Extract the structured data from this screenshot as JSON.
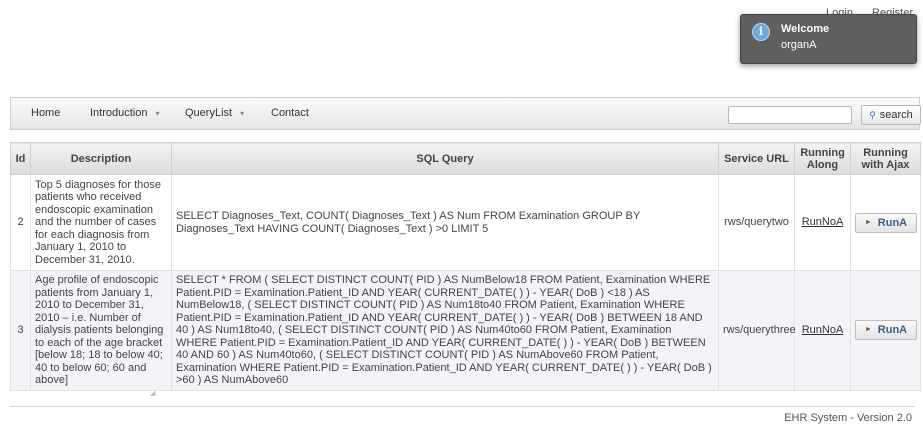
{
  "top_links": {
    "login": "Login",
    "register": "Register"
  },
  "toast": {
    "title": "Welcome",
    "message": "organA",
    "icon": "info-icon"
  },
  "nav": {
    "items": [
      {
        "label": "Home"
      },
      {
        "label": "Introduction",
        "caret": "▾"
      },
      {
        "label": "QueryList",
        "caret": "▾"
      },
      {
        "label": "Contact"
      }
    ],
    "search": {
      "value": "",
      "button_label": "search",
      "icon": "search-icon"
    }
  },
  "table": {
    "headers": [
      "Id",
      "Description",
      "SQL Query",
      "Service URL",
      "Running Along",
      "Running with Ajax"
    ],
    "rows": [
      {
        "id": "2",
        "description": "Top 5 diagnoses for those patients who received endoscopic examination and the number of cases for each diagnosis from January 1, 2010 to December 31, 2010.",
        "sql": "SELECT Diagnoses_Text, COUNT( Diagnoses_Text ) AS Num FROM Examination GROUP BY Diagnoses_Text HAVING COUNT( Diagnoses_Text ) >0 LIMIT 5",
        "url": "rws/querytwo",
        "run": "RunNoA",
        "ajax": "RunA"
      },
      {
        "id": "3",
        "description": "Age profile of endoscopic patients from January 1, 2010 to December 31, 2010 – i.e. Number of dialysis patients belonging to each of the age bracket [below 18; 18 to below 40; 40 to below 60; 60 and above]",
        "sql": "SELECT * FROM ( SELECT DISTINCT COUNT( PID ) AS NumBelow18 FROM Patient, Examination WHERE Patient.PID = Examination.Patient_ID AND YEAR( CURRENT_DATE( ) ) - YEAR( DoB ) <18 ) AS NumBelow18, ( SELECT DISTINCT COUNT( PID ) AS Num18to40 FROM Patient, Examination WHERE Patient.PID = Examination.Patient_ID AND YEAR( CURRENT_DATE( ) ) - YEAR( DoB ) BETWEEN 18 AND 40 ) AS Num18to40, ( SELECT DISTINCT COUNT( PID ) AS Num40to60 FROM Patient, Examination WHERE Patient.PID = Examination.Patient_ID AND YEAR( CURRENT_DATE( ) ) - YEAR( DoB ) BETWEEN 40 AND 60 ) AS Num40to60, ( SELECT DISTINCT COUNT( PID ) AS NumAbove60 FROM Patient, Examination WHERE Patient.PID = Examination.Patient_ID AND YEAR( CURRENT_DATE( ) ) - YEAR( DoB ) >60 ) AS NumAbove60",
        "url": "rws/querythree",
        "run": "RunNoA",
        "ajax": "RunA"
      }
    ]
  },
  "footer": {
    "text": "EHR System - Version 2.0"
  }
}
